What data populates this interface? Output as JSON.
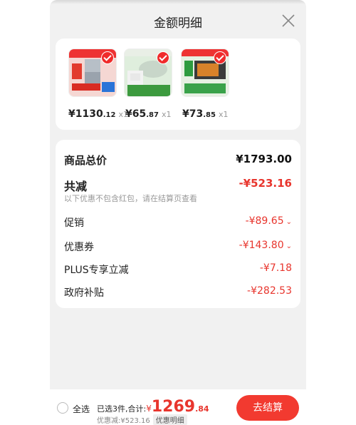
{
  "panel": {
    "title": "金额明细"
  },
  "products": [
    {
      "price_int": "¥1130",
      "price_dec": ".12",
      "qty": "x1"
    },
    {
      "price_int": "¥65",
      "price_dec": ".87",
      "qty": "x1"
    },
    {
      "price_int": "¥73",
      "price_dec": ".85",
      "qty": "x1"
    }
  ],
  "summary": {
    "total_label": "商品总价",
    "total_amount": "¥1793.00",
    "reduce_label": "共减",
    "reduce_amount": "-¥523.16",
    "note": "以下优惠不包含红包，请在结算页查看",
    "rows": [
      {
        "label": "促销",
        "amount": "-¥89.65"
      },
      {
        "label": "优惠券",
        "amount": "-¥143.80"
      },
      {
        "label": "PLUS专享立减",
        "amount": "-¥7.18"
      },
      {
        "label": "政府补贴",
        "amount": "-¥282.53"
      }
    ]
  },
  "bottom_bar": {
    "select_all": "全选",
    "selected_text": "已选3件,合计:",
    "yen": "¥",
    "total_int": "1269",
    "total_dec": ".84",
    "discount_text": "优惠减:¥523.16",
    "detail_button": "优惠明细",
    "checkout_button": "去结算"
  },
  "colors": {
    "accent": "#e8352d",
    "checkout": "#f23a30",
    "sheet_bg": "#f1f1f1"
  }
}
